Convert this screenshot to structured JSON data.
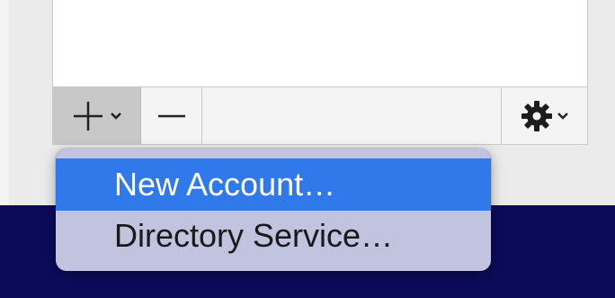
{
  "toolbar": {
    "add_icon": "plus-icon",
    "add_chevron_icon": "chevron-down-icon",
    "remove_icon": "minus-icon",
    "action_icon": "gear-icon",
    "action_chevron_icon": "chevron-down-icon"
  },
  "menu": {
    "items": [
      {
        "label": "New Account…",
        "selected": true
      },
      {
        "label": "Directory Service…",
        "selected": false
      }
    ]
  },
  "colors": {
    "selection": "#2f79ea",
    "menu_background": "#c2c3df",
    "desktop": "#0b0b5a"
  }
}
